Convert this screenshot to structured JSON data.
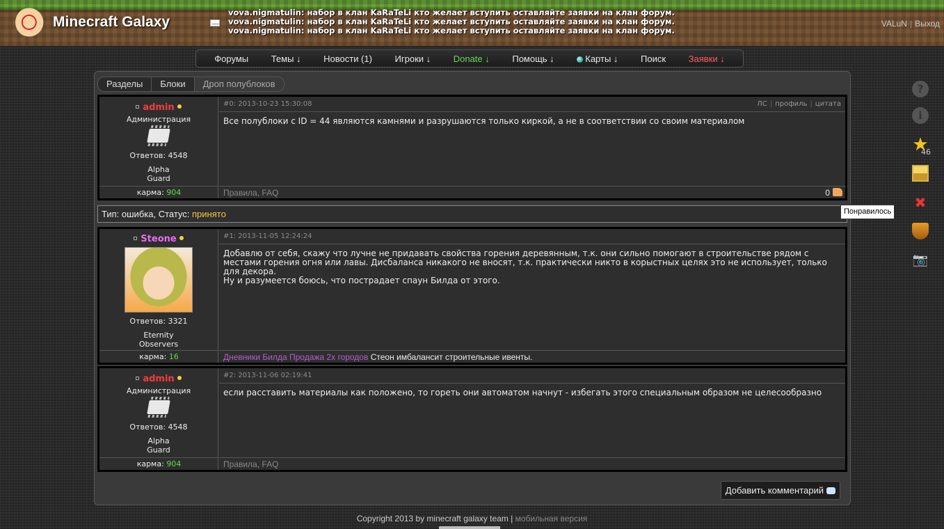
{
  "header": {
    "logo_text": "Minecraft Galaxy",
    "ticker": [
      "vova.nigmatulin: набор в клан KaRaTeLi кто желает вступить оставляйте заявки на клан форум.",
      "vova.nigmatulin: набор в клан KaRaTeLi кто желает вступить оставляйте заявки на клан форум.",
      "vova.nigmatulin: набор в клан KaRaTeLi кто желает вступить оставляйте заявки на клан форум."
    ],
    "username": "VALuN",
    "separator": "|",
    "logout": "Выход"
  },
  "nav": {
    "forums": "Форумы",
    "topics": "Темы ↓",
    "news": "Новости (1)",
    "players": "Игроки ↓",
    "donate": "Donate ↓",
    "help": "Помощь ↓",
    "maps": "Карты ↓",
    "search": "Поиск",
    "requests": "Заявки ↓"
  },
  "breadcrumbs": [
    "Разделы",
    "Блоки",
    "Дроп полублоков"
  ],
  "posts": [
    {
      "author": "admin",
      "role": "Администрация",
      "answers": "Ответов: 4548",
      "group_line1": "Alpha",
      "group_line2": "Guard",
      "karma_label": "карма:",
      "karma_value": "904",
      "meta": "#0: 2013-10-23 15:30:08",
      "actions": [
        "ЛС",
        "профиль",
        "цитата"
      ],
      "body": "Все полублоки с ID = 44 являются камнями и разрушаются только киркой, а не в соответствии со своим материалом",
      "footer_link1": "Правила",
      "footer_sep": ", ",
      "footer_link2": "FAQ",
      "likes": "0"
    },
    {
      "author": "Steone",
      "answers": "Ответов: 3321",
      "group_line1": "Eternity",
      "group_line2": "Observers",
      "karma_label": "карма:",
      "karma_value": "16",
      "meta": "#1: 2013-11-05 12:24:24",
      "body": "Добавлю от себя, скажу что лучне не придавать свойства горения деревянным, т.к. они сильно помогают в строительстве рядом с местами горения огня или лавы. Дисбаланса никакого не вносят, т.к. практически никто в корыстных целях это не использует, только для декора.",
      "body2": "Ну и разумеется боюсь, что пострадает спаун Билда от этого.",
      "footer_link": "Дневники Билда Продажа 2х городов",
      "footer_text": " Стеон имбалансит строительные ивенты."
    },
    {
      "author": "admin",
      "role": "Администрация",
      "answers": "Ответов: 4548",
      "group_line1": "Alpha",
      "group_line2": "Guard",
      "karma_label": "карма:",
      "karma_value": "904",
      "meta": "#2: 2013-11-06 02:19:41",
      "body": "если расставить материалы как положено, то гореть они автоматом начнут - избегать этого специальным образом не целесообразно",
      "footer_link1": "Правила",
      "footer_sep": ", ",
      "footer_link2": "FAQ"
    }
  ],
  "status": {
    "prefix": "Тип: ошибка, Статус: ",
    "value": "принято"
  },
  "add_comment": "Добавить комментарий",
  "tooltip": "Понравилось",
  "side": {
    "help": "?",
    "info": "i",
    "star": "★",
    "star_count": "46",
    "tools": "✖",
    "camera": "📷"
  },
  "footer": {
    "copyright": "Copyright 2013 by minecraft galaxy team",
    "sep": " | ",
    "mobile": "мобильная версия"
  },
  "colors": {
    "admin_name": "#f23d3d",
    "steone_name": "#e86cf0",
    "karma": "#6dd35a",
    "status_accepted": "#f5c842",
    "donate": "#6dd35a",
    "requests": "#ff5b5b"
  }
}
